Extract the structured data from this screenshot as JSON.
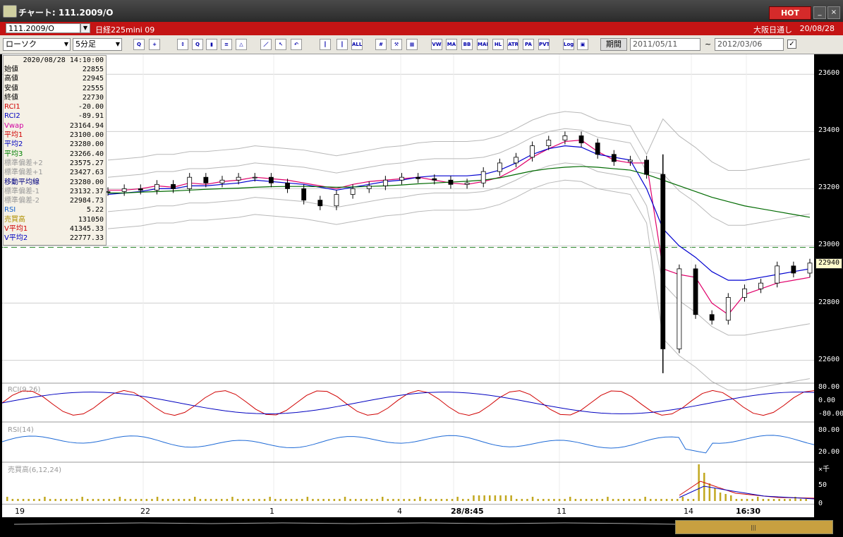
{
  "window": {
    "title": "チャート: 111.2009/O",
    "hot_label": "HOT",
    "minimize": "_",
    "close": "×"
  },
  "infobar": {
    "symbol": "111.2009/O",
    "name": "日経225mini 09",
    "market": "大阪日通し",
    "date": "20/08/28"
  },
  "toolbar": {
    "chart_type": "ローソク",
    "interval": "5分足",
    "period_label": "期間",
    "date_from": "2011/05/11",
    "date_to": "2012/03/06",
    "tilde": "~",
    "icons": [
      {
        "name": "zoom-icon",
        "text": "Q"
      },
      {
        "name": "crosshair-icon",
        "text": "+"
      },
      {
        "name": "drag-icon",
        "text": "↕"
      },
      {
        "name": "magnify-icon",
        "text": "Q"
      },
      {
        "name": "bar-chart-icon",
        "text": "▮"
      },
      {
        "name": "compare-icon",
        "text": "≡"
      },
      {
        "name": "scale-icon",
        "text": "△"
      },
      {
        "name": "trendline-icon",
        "text": "／"
      },
      {
        "name": "cursor-icon",
        "text": "↖"
      },
      {
        "name": "undo-icon",
        "text": "↶"
      },
      {
        "name": "candle1-icon",
        "text": "┃"
      },
      {
        "name": "candle2-icon",
        "text": "┃"
      },
      {
        "name": "all-icon",
        "text": "ALL"
      },
      {
        "name": "pattern-icon",
        "text": "#"
      },
      {
        "name": "tool-icon",
        "text": "⚒"
      },
      {
        "name": "color-icon",
        "text": "▦"
      },
      {
        "name": "vwap-icon",
        "text": "VW"
      },
      {
        "name": "ma-icon",
        "text": "MA"
      },
      {
        "name": "bb-icon",
        "text": "BB"
      },
      {
        "name": "mae-icon",
        "text": "MAE"
      },
      {
        "name": "hl-icon",
        "text": "HL"
      },
      {
        "name": "atr-icon",
        "text": "ATR"
      },
      {
        "name": "para-icon",
        "text": "PA"
      },
      {
        "name": "pvt-icon",
        "text": "PVT"
      },
      {
        "name": "log-icon",
        "text": "Log"
      },
      {
        "name": "export-icon",
        "text": "▣"
      }
    ]
  },
  "ohlc": {
    "datetime": "2020/08/28  14:10:00",
    "rows": [
      {
        "label": "始値",
        "value": "22855",
        "color": "#000"
      },
      {
        "label": "高値",
        "value": "22945",
        "color": "#000"
      },
      {
        "label": "安値",
        "value": "22555",
        "color": "#000"
      },
      {
        "label": "終値",
        "value": "22730",
        "color": "#000"
      },
      {
        "label": "RCI1",
        "value": "-20.00",
        "color": "#d00000"
      },
      {
        "label": "RCI2",
        "value": "-89.91",
        "color": "#0000c0"
      },
      {
        "label": "Vwap",
        "value": "23164.94",
        "color": "#d000a0"
      },
      {
        "label": "平均1",
        "value": "23100.00",
        "color": "#d00000"
      },
      {
        "label": "平均2",
        "value": "23280.00",
        "color": "#0000c0"
      },
      {
        "label": "平均3",
        "value": "23266.40",
        "color": "#008000"
      },
      {
        "label": "標準偏差+2",
        "value": "23575.27",
        "color": "#999"
      },
      {
        "label": "標準偏差+1",
        "value": "23427.63",
        "color": "#999"
      },
      {
        "label": "移動平均線",
        "value": "23280.00",
        "color": "#000080"
      },
      {
        "label": "標準偏差-1",
        "value": "23132.37",
        "color": "#999"
      },
      {
        "label": "標準偏差-2",
        "value": "22984.73",
        "color": "#999"
      },
      {
        "label": "RSI",
        "value": "5.22",
        "color": "#1060d0"
      },
      {
        "label": "売買高",
        "value": "131050",
        "color": "#b09000"
      },
      {
        "label": "V平均1",
        "value": "41345.33",
        "color": "#d00000"
      },
      {
        "label": "V平均2",
        "value": "22777.33",
        "color": "#0000c0"
      }
    ]
  },
  "chart_data": {
    "type": "line",
    "title": "",
    "price_axis_ticks": [
      "23600",
      "23400",
      "23200",
      "23000",
      "22800",
      "22600"
    ],
    "ylim": [
      22530,
      23650
    ],
    "last_price": "22940",
    "reference_level": 22995,
    "rci_label": "RCI(9,26)",
    "rci_ticks": [
      "80.00",
      "0.00",
      "-80.00"
    ],
    "rsi_label": "RSI(14)",
    "rsi_ticks": [
      "80.00",
      "20.00"
    ],
    "volume_label": "売買高(6,12,24)",
    "volume_ticks": [
      "×千",
      "50",
      "0"
    ],
    "x_labels": [
      {
        "text": "19",
        "bold": false
      },
      {
        "text": "22",
        "bold": false
      },
      {
        "text": "1",
        "bold": false
      },
      {
        "text": "4",
        "bold": false
      },
      {
        "text": "28/8:45",
        "bold": true
      },
      {
        "text": "11",
        "bold": false
      },
      {
        "text": "14",
        "bold": false
      },
      {
        "text": "16:30",
        "bold": true
      }
    ],
    "series": [
      {
        "name": "平均1",
        "color": "#e0006a",
        "values": [
          23195,
          23195,
          23200,
          23210,
          23205,
          23220,
          23215,
          23225,
          23230,
          23240,
          23235,
          23230,
          23220,
          23210,
          23200,
          23215,
          23225,
          23230,
          23235,
          23240,
          23230,
          23220,
          23215,
          23225,
          23240,
          23270,
          23310,
          23340,
          23365,
          23370,
          23330,
          23300,
          23290,
          23290,
          22920,
          22900,
          22890,
          22800,
          22760,
          22830,
          22850,
          22870,
          22880,
          22890
        ]
      },
      {
        "name": "平均2",
        "color": "#0000d0",
        "values": [
          23180,
          23185,
          23190,
          23200,
          23200,
          23210,
          23210,
          23215,
          23220,
          23230,
          23225,
          23220,
          23215,
          23205,
          23195,
          23205,
          23215,
          23225,
          23230,
          23240,
          23245,
          23245,
          23245,
          23250,
          23265,
          23290,
          23320,
          23340,
          23350,
          23345,
          23320,
          23310,
          23300,
          23200,
          23060,
          23000,
          22960,
          22910,
          22880,
          22880,
          22890,
          22900,
          22910,
          22920
        ]
      },
      {
        "name": "平均3",
        "color": "#006a00",
        "values": [
          23185,
          23185,
          23188,
          23190,
          23192,
          23195,
          23198,
          23200,
          23202,
          23205,
          23207,
          23208,
          23208,
          23207,
          23205,
          23206,
          23208,
          23210,
          23213,
          23217,
          23220,
          23223,
          23226,
          23230,
          23238,
          23250,
          23262,
          23270,
          23275,
          23278,
          23275,
          23270,
          23265,
          23250,
          23230,
          23210,
          23190,
          23170,
          23155,
          23140,
          23130,
          23120,
          23110,
          23100
        ]
      }
    ],
    "candles_close": [
      23190,
      23200,
      23195,
      23215,
      23200,
      23240,
      23220,
      23230,
      23240,
      23240,
      23220,
      23200,
      23160,
      23140,
      23180,
      23200,
      23210,
      23230,
      23240,
      23235,
      23230,
      23215,
      23220,
      23260,
      23290,
      23310,
      23350,
      23370,
      23385,
      23360,
      23320,
      23295,
      23300,
      23250,
      22640,
      22920,
      22760,
      22740,
      22820,
      22850,
      22870,
      22930,
      22905,
      22940
    ]
  }
}
